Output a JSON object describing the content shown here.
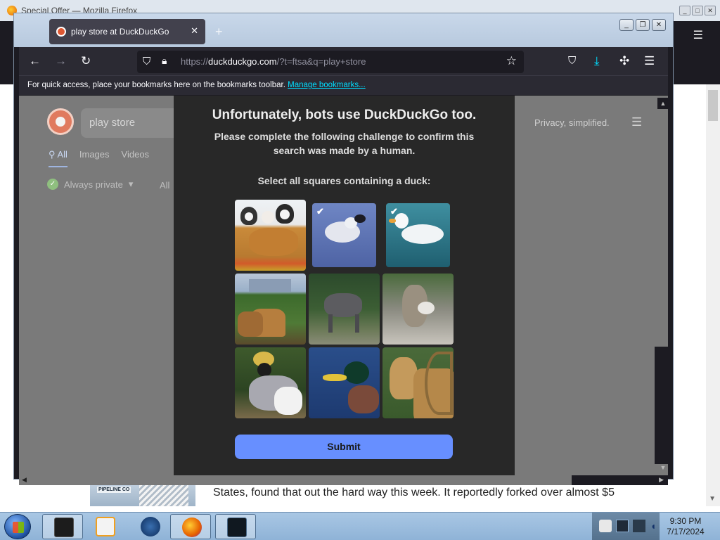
{
  "background_window": {
    "title": "Special Offer — Mozilla Firefox",
    "article_text": "States, found that out the hard way this week. It reportedly forked over almost $5",
    "image_caption": "PIPELINE CO"
  },
  "browser": {
    "tab": {
      "title": "play store at DuckDuckGo",
      "close_glyph": "✕"
    },
    "new_tab_glyph": "+",
    "url": {
      "prefix": "https://",
      "domain": "duckduckgo.com",
      "path": "/?t=ftsa&q=play+store"
    },
    "bookmarks_bar": {
      "message": "For quick access, place your bookmarks here on the bookmarks toolbar.",
      "link": "Manage bookmarks..."
    },
    "toolbar_icons": [
      "back-icon",
      "forward-icon",
      "reload-icon",
      "shield-icon",
      "lock-icon",
      "star-icon",
      "pocket-icon",
      "downloads-icon",
      "extensions-icon",
      "menu-icon"
    ]
  },
  "page": {
    "search_query": "play store",
    "tabs": [
      {
        "label": "All",
        "active": true
      },
      {
        "label": "Images",
        "active": false
      },
      {
        "label": "Videos",
        "active": false
      }
    ],
    "private_label": "Always private",
    "all_label": "All",
    "tagline": "Privacy, simplified."
  },
  "challenge": {
    "title": "Unfortunately, bots use DuckDuckGo too.",
    "subtitle": "Please complete the following challenge to confirm this search was made by a human.",
    "instruction": "Select all squares containing a duck:",
    "submit_label": "Submit",
    "check_glyph": "✔",
    "tiles": [
      {
        "content": "puppies-and-cat",
        "selected": false
      },
      {
        "content": "duck",
        "selected": true
      },
      {
        "content": "duck",
        "selected": true
      },
      {
        "content": "giraffes",
        "selected": false
      },
      {
        "content": "gnu",
        "selected": false
      },
      {
        "content": "animal-feeding",
        "selected": false
      },
      {
        "content": "crowned-crane",
        "selected": false
      },
      {
        "content": "mallard-duck",
        "selected": false
      },
      {
        "content": "giraffe",
        "selected": false
      }
    ]
  },
  "taskbar": {
    "clock_time": "9:30 PM",
    "clock_date": "7/17/2024"
  },
  "colors": {
    "accent_blue": "#678fff",
    "modal_bg": "#282828",
    "toolbar_bg": "#2b2a33",
    "link": "#00ddff"
  }
}
